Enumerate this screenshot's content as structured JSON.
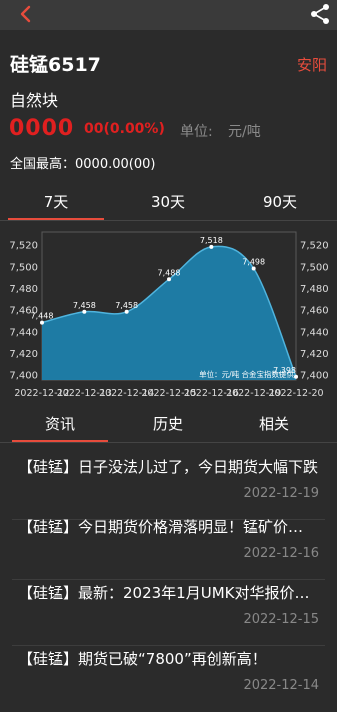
{
  "header": {
    "title": "硅锰6517",
    "city": "安阳",
    "subtitle": "自然块"
  },
  "quote": {
    "price": "0000",
    "change": "00(0.00%)",
    "unit_label": "单位:",
    "unit_value": "元/吨",
    "national_high": "全国最高：0000.00(00)"
  },
  "range_tabs": [
    {
      "label": "7天"
    },
    {
      "label": "30天"
    },
    {
      "label": "90天"
    }
  ],
  "chart_data": {
    "type": "area",
    "x": [
      "2022-12-12",
      "2022-12-13",
      "2022-12-14",
      "2022-12-15",
      "2022-12-16",
      "2022-12-19",
      "2022-12-20"
    ],
    "values": [
      7448,
      7458,
      7458,
      7488,
      7518,
      7498,
      7398
    ],
    "yticks": [
      7400,
      7420,
      7440,
      7460,
      7480,
      7500,
      7520
    ],
    "ylim": [
      7395,
      7528
    ],
    "note": "单位：元/吨 合金宝指数提供",
    "fill": "#1e7fab",
    "line": "#4fb4de"
  },
  "info_tabs": [
    {
      "label": "资讯"
    },
    {
      "label": "历史"
    },
    {
      "label": "相关"
    }
  ],
  "news": [
    {
      "title": "【硅锰】日子没法儿过了，今日期货大幅下跌",
      "date": "2022-12-19"
    },
    {
      "title": "【硅锰】今日期货价格滑落明显！锰矿价格松动",
      "date": "2022-12-16"
    },
    {
      "title": "【硅锰】最新：2023年1月UMK对华报价出炉",
      "date": "2022-12-15"
    },
    {
      "title": "【硅锰】期货已破“7800”再创新高！",
      "date": "2022-12-14"
    }
  ]
}
